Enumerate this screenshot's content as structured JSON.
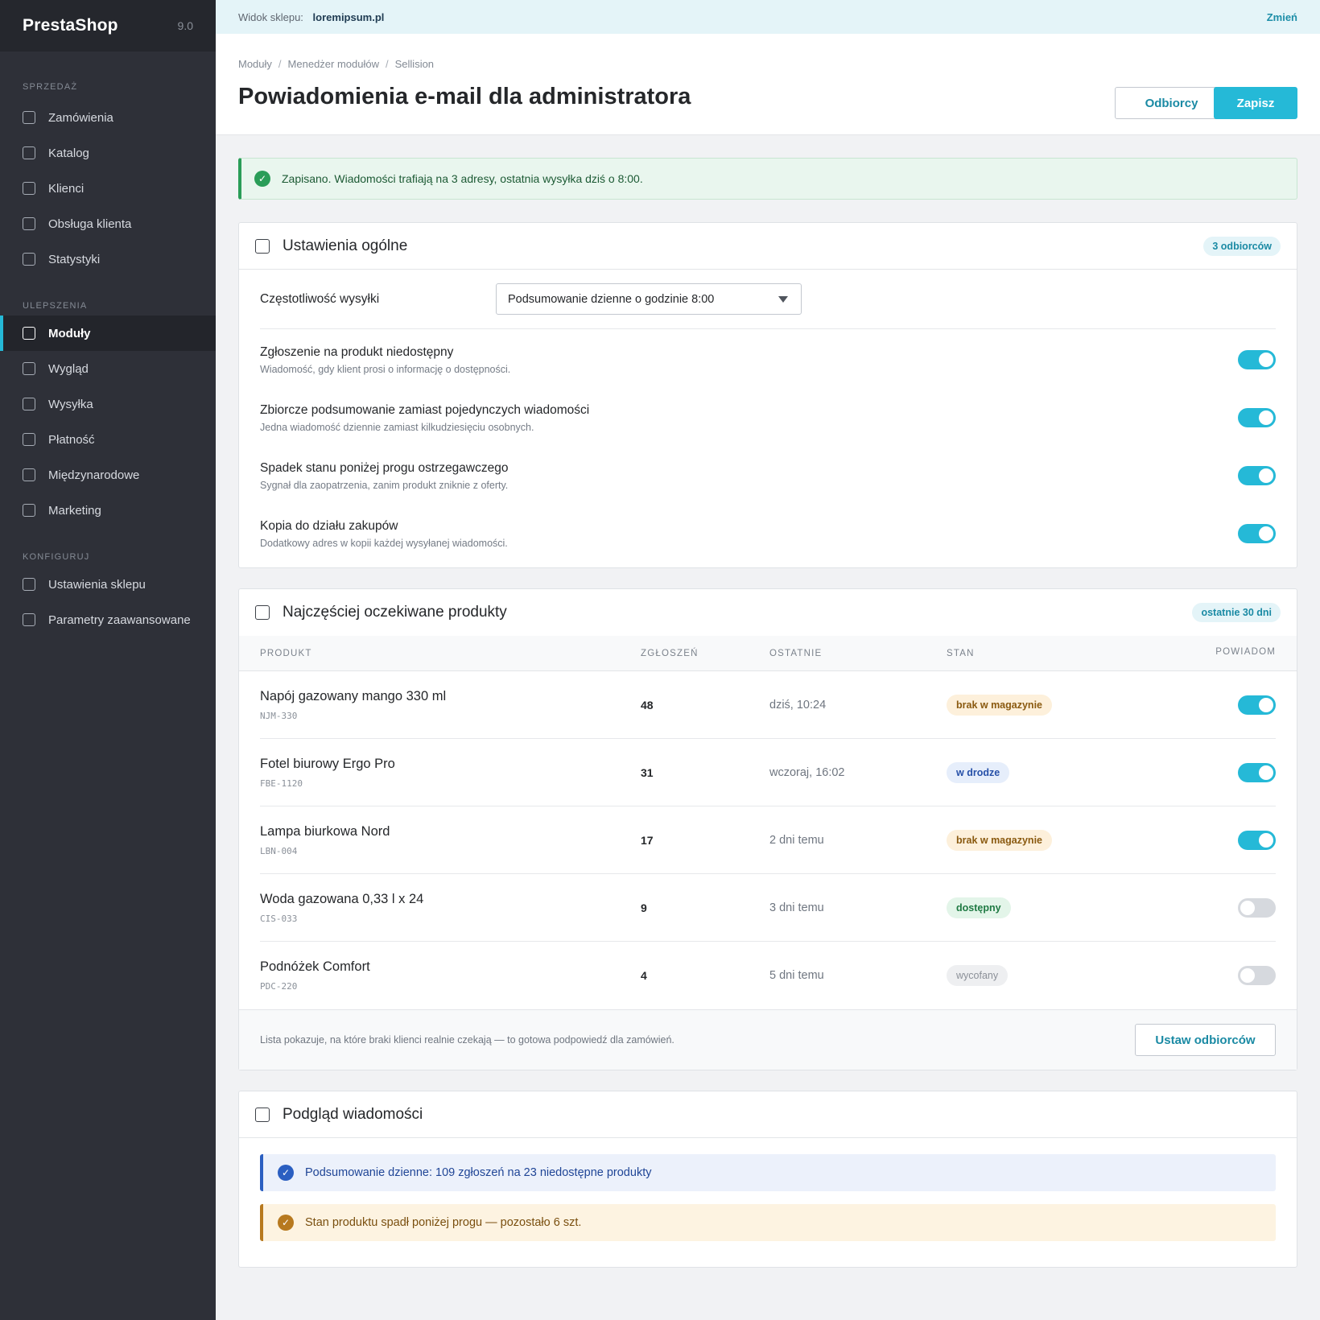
{
  "brand": {
    "name": "PrestaShop",
    "version": "9.0"
  },
  "sidebar": {
    "sections": [
      {
        "title": "SPRZEDAŻ",
        "items": [
          "Zamówienia",
          "Katalog",
          "Klienci",
          "Obsługa klienta",
          "Statystyki"
        ]
      },
      {
        "title": "ULEPSZENIA",
        "items": [
          "Moduły",
          "Wygląd",
          "Wysyłka",
          "Płatność",
          "Międzynarodowe",
          "Marketing"
        ]
      },
      {
        "title": "KONFIGURUJ",
        "items": [
          "Ustawienia sklepu",
          "Parametry zaawansowane"
        ]
      }
    ],
    "active": "Moduły"
  },
  "topbar": {
    "shop_label": "Widok sklepu:",
    "shop_name": "loremipsum.pl",
    "change_label": "Zmień"
  },
  "breadcrumb": [
    "Moduły",
    "Menedżer modułów",
    "Sellision"
  ],
  "page_title": "Powiadomienia e-mail dla administratora",
  "header_buttons": {
    "recipients": "Odbiorcy",
    "save": "Zapisz"
  },
  "alert_success": "Zapisano. Wiadomości trafiają na 3 adresy, ostatnia wysyłka dziś o 8:00.",
  "general": {
    "title": "Ustawienia ogólne",
    "pill": "3 odbiorców",
    "frequency_label": "Częstotliwość wysyłki",
    "frequency_value": "Podsumowanie dzienne o godzinie 8:00",
    "toggles": [
      {
        "title": "Zgłoszenie na produkt niedostępny",
        "desc": "Wiadomość, gdy klient prosi o informację o dostępności.",
        "on": true
      },
      {
        "title": "Zbiorcze podsumowanie zamiast pojedynczych wiadomości",
        "desc": "Jedna wiadomość dziennie zamiast kilkudziesięciu osobnych.",
        "on": true
      },
      {
        "title": "Spadek stanu poniżej progu ostrzegawczego",
        "desc": "Sygnał dla zaopatrzenia, zanim produkt zniknie z oferty.",
        "on": true
      },
      {
        "title": "Kopia do działu zakupów",
        "desc": "Dodatkowy adres w kopii każdej wysyłanej wiadomości.",
        "on": true
      }
    ]
  },
  "products": {
    "title": "Najczęściej oczekiwane produkty",
    "pill": "ostatnie 30 dni",
    "columns": {
      "product": "PRODUKT",
      "requests": "ZGŁOSZEŃ",
      "last": "OSTATNIE",
      "status": "STAN",
      "notify": "POWIADOM"
    },
    "rows": [
      {
        "name": "Napój gazowany mango 330 ml",
        "sku": "NJM-330",
        "requests": "48",
        "last": "dziś, 10:24",
        "status": "brak w magazynie",
        "status_type": "warn",
        "notify": true
      },
      {
        "name": "Fotel biurowy Ergo Pro",
        "sku": "FBE-1120",
        "requests": "31",
        "last": "wczoraj, 16:02",
        "status": "w drodze",
        "status_type": "info",
        "notify": true
      },
      {
        "name": "Lampa biurkowa Nord",
        "sku": "LBN-004",
        "requests": "17",
        "last": "2 dni temu",
        "status": "brak w magazynie",
        "status_type": "warn",
        "notify": true
      },
      {
        "name": "Woda gazowana 0,33 l x 24",
        "sku": "CIS-033",
        "requests": "9",
        "last": "3 dni temu",
        "status": "dostępny",
        "status_type": "ok",
        "notify": false
      },
      {
        "name": "Podnóżek Comfort",
        "sku": "PDC-220",
        "requests": "4",
        "last": "5 dni temu",
        "status": "wycofany",
        "status_type": "muted",
        "notify": false
      }
    ],
    "footer_note": "Lista pokazuje, na które braki klienci realnie czekają — to gotowa podpowiedź dla zamówień.",
    "footer_button": "Ustaw odbiorców"
  },
  "preview": {
    "title": "Podgląd wiadomości",
    "messages": [
      {
        "text": "Podsumowanie dzienne: 109 zgłoszeń na 23 niedostępne produkty",
        "type": "blue"
      },
      {
        "text": "Stan produktu spadł poniżej progu — pozostało 6 szt.",
        "type": "amber"
      }
    ]
  }
}
